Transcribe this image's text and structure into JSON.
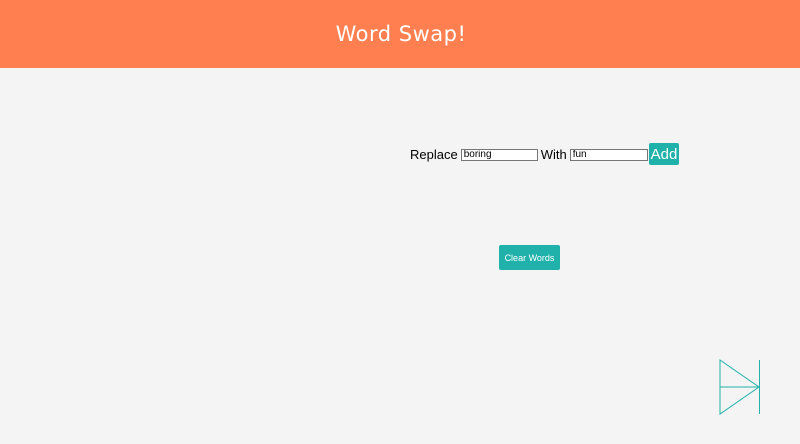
{
  "header": {
    "title": "Word Swap!",
    "background_color": "#ff7f50"
  },
  "swap_form": {
    "replace_label": "Replace",
    "replace_value": "boring",
    "with_label": "With",
    "with_value": "fun",
    "add_label": "Add"
  },
  "actions": {
    "clear_label": "Clear Words",
    "accent_color": "#20b2aa"
  },
  "navigation": {
    "next_icon": "skip-forward-icon"
  }
}
